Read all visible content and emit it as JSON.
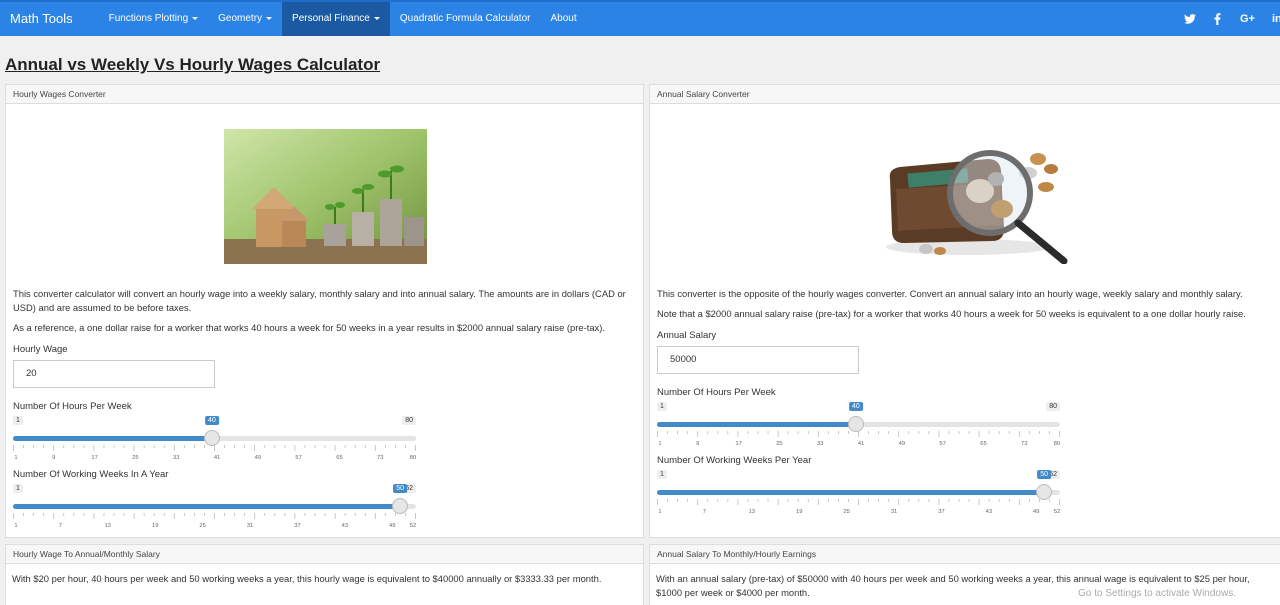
{
  "nav": {
    "brand": "Math Tools",
    "items": [
      {
        "label": "Functions Plotting",
        "dropdown": true,
        "active": false
      },
      {
        "label": "Geometry",
        "dropdown": true,
        "active": false
      },
      {
        "label": "Personal Finance",
        "dropdown": true,
        "active": true
      },
      {
        "label": "Quadratic Formula Calculator",
        "dropdown": false,
        "active": false
      },
      {
        "label": "About",
        "dropdown": false,
        "active": false
      }
    ],
    "social": [
      "twitter-icon",
      "facebook-icon",
      "google-plus-icon",
      "linkedin-icon"
    ],
    "social_glyphs": {
      "g": "G+",
      "in": "in"
    }
  },
  "page_title": "Annual vs Weekly Vs Hourly Wages Calculator",
  "left": {
    "heading": "Hourly Wages Converter",
    "para1": "This converter calculator will convert an hourly wage into a weekly salary, monthly salary and into annual salary. The amounts are in dollars (CAD or USD) and are assumed to be before taxes.",
    "para2": "As a reference, a one dollar raise for a worker that works 40 hours a week for 50 weeks in a year results in $2000 annual salary raise (pre-tax).",
    "wage_label": "Hourly Wage",
    "wage_value": "20",
    "hours_label": "Number Of Hours Per Week",
    "hours": {
      "min": 1,
      "max": 80,
      "value": 40,
      "min_label": "1",
      "max_label": "80",
      "value_label": "40",
      "ticks": [
        "1",
        "9",
        "17",
        "25",
        "33",
        "41",
        "49",
        "57",
        "65",
        "73",
        "80"
      ]
    },
    "weeks_label": "Number Of Working Weeks In A Year",
    "weeks": {
      "min": 1,
      "max": 52,
      "value": 50,
      "min_label": "1",
      "max_label": "52",
      "value_label": "50",
      "ticks": [
        "1",
        "7",
        "13",
        "19",
        "25",
        "31",
        "37",
        "43",
        "49",
        "52"
      ]
    }
  },
  "right": {
    "heading": "Annual Salary Converter",
    "para1": "This converter is the opposite of the hourly wages converter. Convert an annual salary into an hourly wage, weekly salary and monthly salary.",
    "para2": "Note that a $2000 annual salary raise (pre-tax) for a worker that works 40 hours a week for 50 weeks is equivalent to a one dollar hourly raise.",
    "salary_label": "Annual Salary",
    "salary_value": "50000",
    "hours_label": "Number Of Hours Per Week",
    "hours": {
      "min": 1,
      "max": 80,
      "value": 40,
      "min_label": "1",
      "max_label": "80",
      "value_label": "40",
      "ticks": [
        "1",
        "9",
        "17",
        "25",
        "33",
        "41",
        "49",
        "57",
        "65",
        "73",
        "80"
      ]
    },
    "weeks_label": "Number Of Working Weeks Per Year",
    "weeks": {
      "min": 1,
      "max": 52,
      "value": 50,
      "min_label": "1",
      "max_label": "52",
      "value_label": "50",
      "ticks": [
        "1",
        "7",
        "13",
        "19",
        "25",
        "31",
        "37",
        "43",
        "49",
        "52"
      ]
    }
  },
  "result_left": {
    "heading": "Hourly Wage To Annual/Monthly Salary",
    "text": "With $20 per hour, 40 hours per week and 50 working weeks a year, this hourly wage is equivalent to $40000 annually or $3333.33 per month."
  },
  "result_right": {
    "heading": "Annual Salary To Monthly/Hourly Earnings",
    "text": "With an annual salary (pre-tax) of $50000 with 40 hours per week and 50 working weeks a year, this annual wage is equivalent to $25 per hour, $1000 per week or $4000 per month."
  },
  "watermark": "Go to Settings to activate Windows."
}
